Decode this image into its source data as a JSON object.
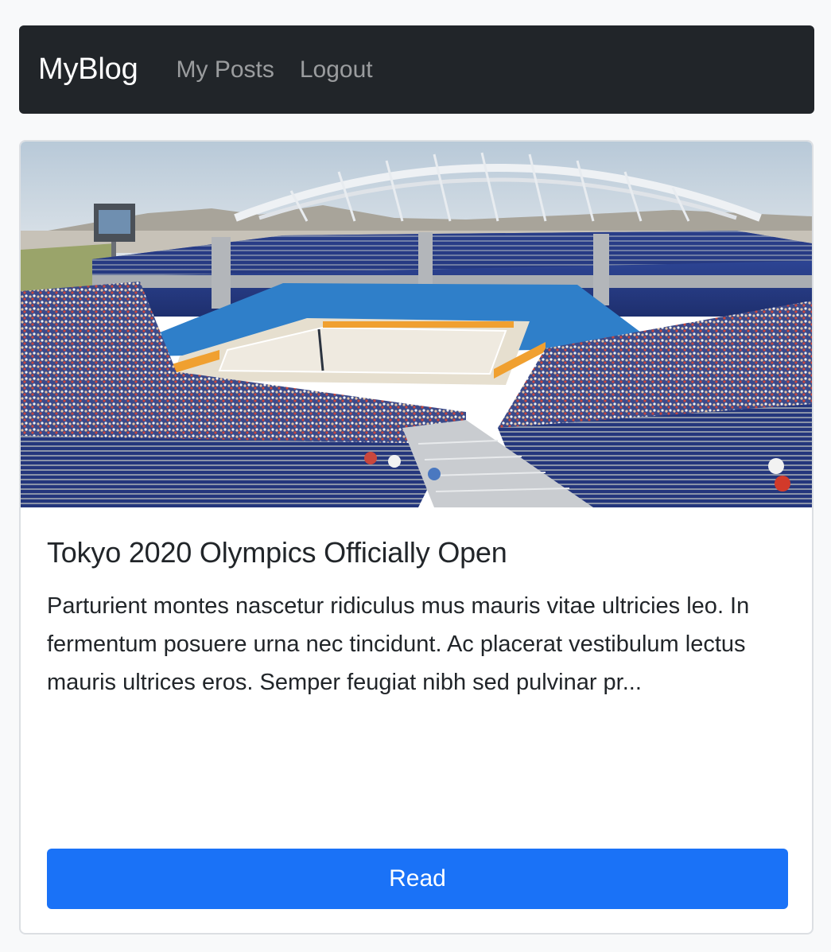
{
  "navbar": {
    "brand": "MyBlog",
    "links": [
      {
        "label": "My Posts"
      },
      {
        "label": "Logout"
      }
    ]
  },
  "post": {
    "title": "Tokyo 2020 Olympics Officially Open",
    "excerpt": "Parturient montes nascetur ridiculus mus mauris vitae ultricies leo. In fermentum posuere urna nec tincidunt. Ac placerat vestibulum lectus mauris ultrices eros. Semper feugiat nibh sed pulvinar pr...",
    "read_label": "Read",
    "image": {
      "subject": "beach volleyball stadium"
    }
  },
  "colors": {
    "navbar_bg": "#212529",
    "page_bg": "#f8f9fa",
    "button_primary": "#1a72f7",
    "nav_link": "#8c8e91",
    "stadium_seats": "#2a3f8f"
  }
}
